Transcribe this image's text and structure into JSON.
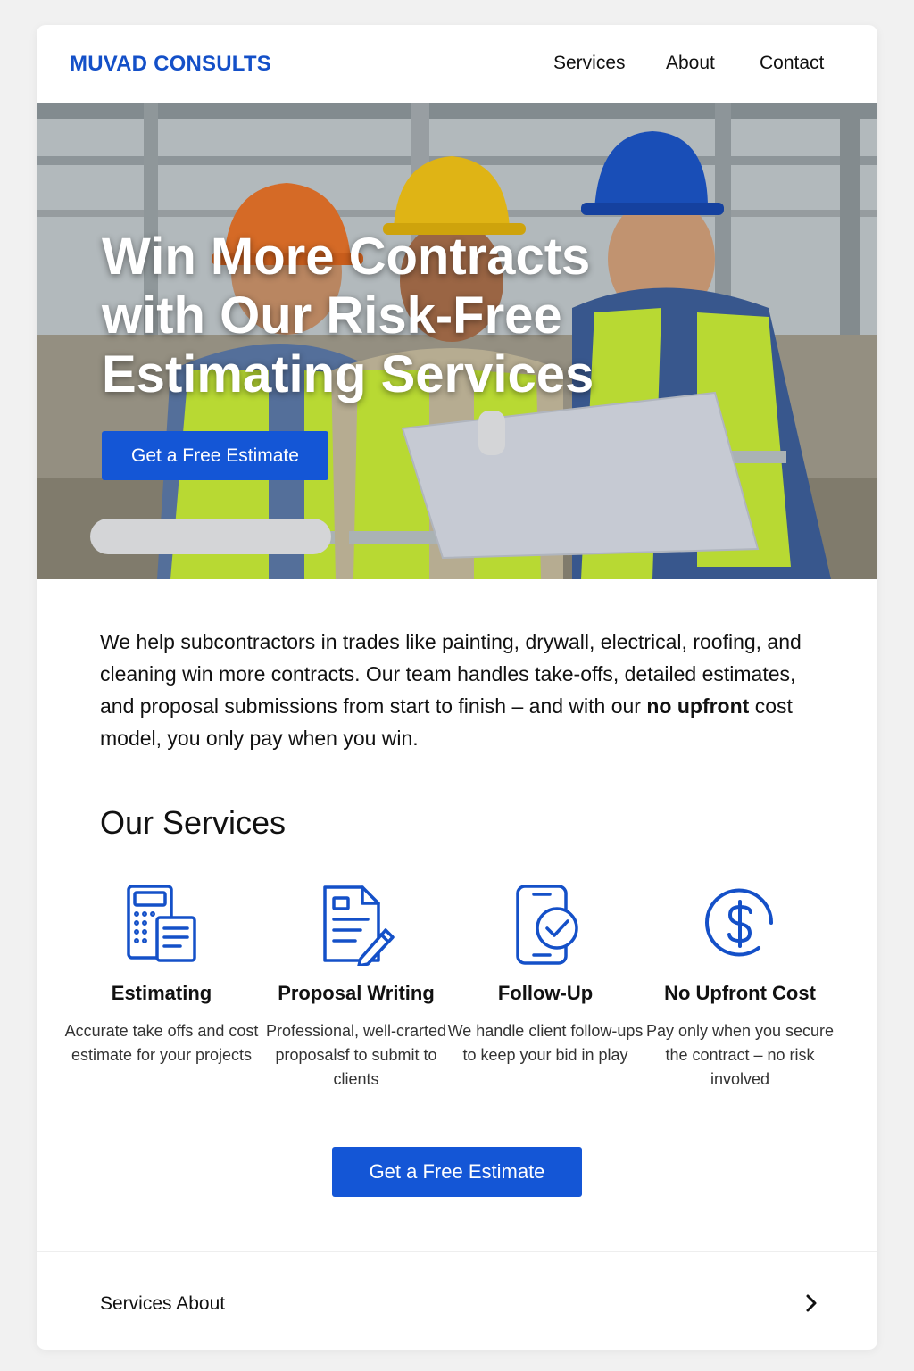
{
  "brand": "MUVAD CONSULTS",
  "nav": [
    "Services",
    "About",
    "Contact"
  ],
  "hero": {
    "title": "Win More Contracts with Our Risk-Free Estimating Services",
    "button": "Get a Free Estimate"
  },
  "intro": {
    "before": "We help subcontractors in trades like painting, drywall, electrical, roofing, and cleaning win more contracts. Our team handles take-offs, detailed estimates, and proposal submissions from start to finish – and with our ",
    "bold": "no upfront",
    "after": " cost model, you only pay when you win."
  },
  "services_title": "Our Services",
  "services": [
    {
      "icon": "calculator-document-icon",
      "title": "Estimating",
      "desc": "Accurate take offs and cost estimate for your projects"
    },
    {
      "icon": "document-pen-icon",
      "title": "Proposal Writing",
      "desc": "Professional, well-crarted proposalsf to submit to clients"
    },
    {
      "icon": "phone-check-icon",
      "title": "Follow-Up",
      "desc": "We handle client follow-ups to keep your bid in play"
    },
    {
      "icon": "dollar-circle-icon",
      "title": "No Upfront Cost",
      "desc": "Pay only when you secure the contract – no risk involved"
    }
  ],
  "cta_button": "Get a Free Estimate",
  "footer": {
    "links": "Services About"
  },
  "colors": {
    "accent": "#1456d6",
    "brand": "#1450c8"
  }
}
